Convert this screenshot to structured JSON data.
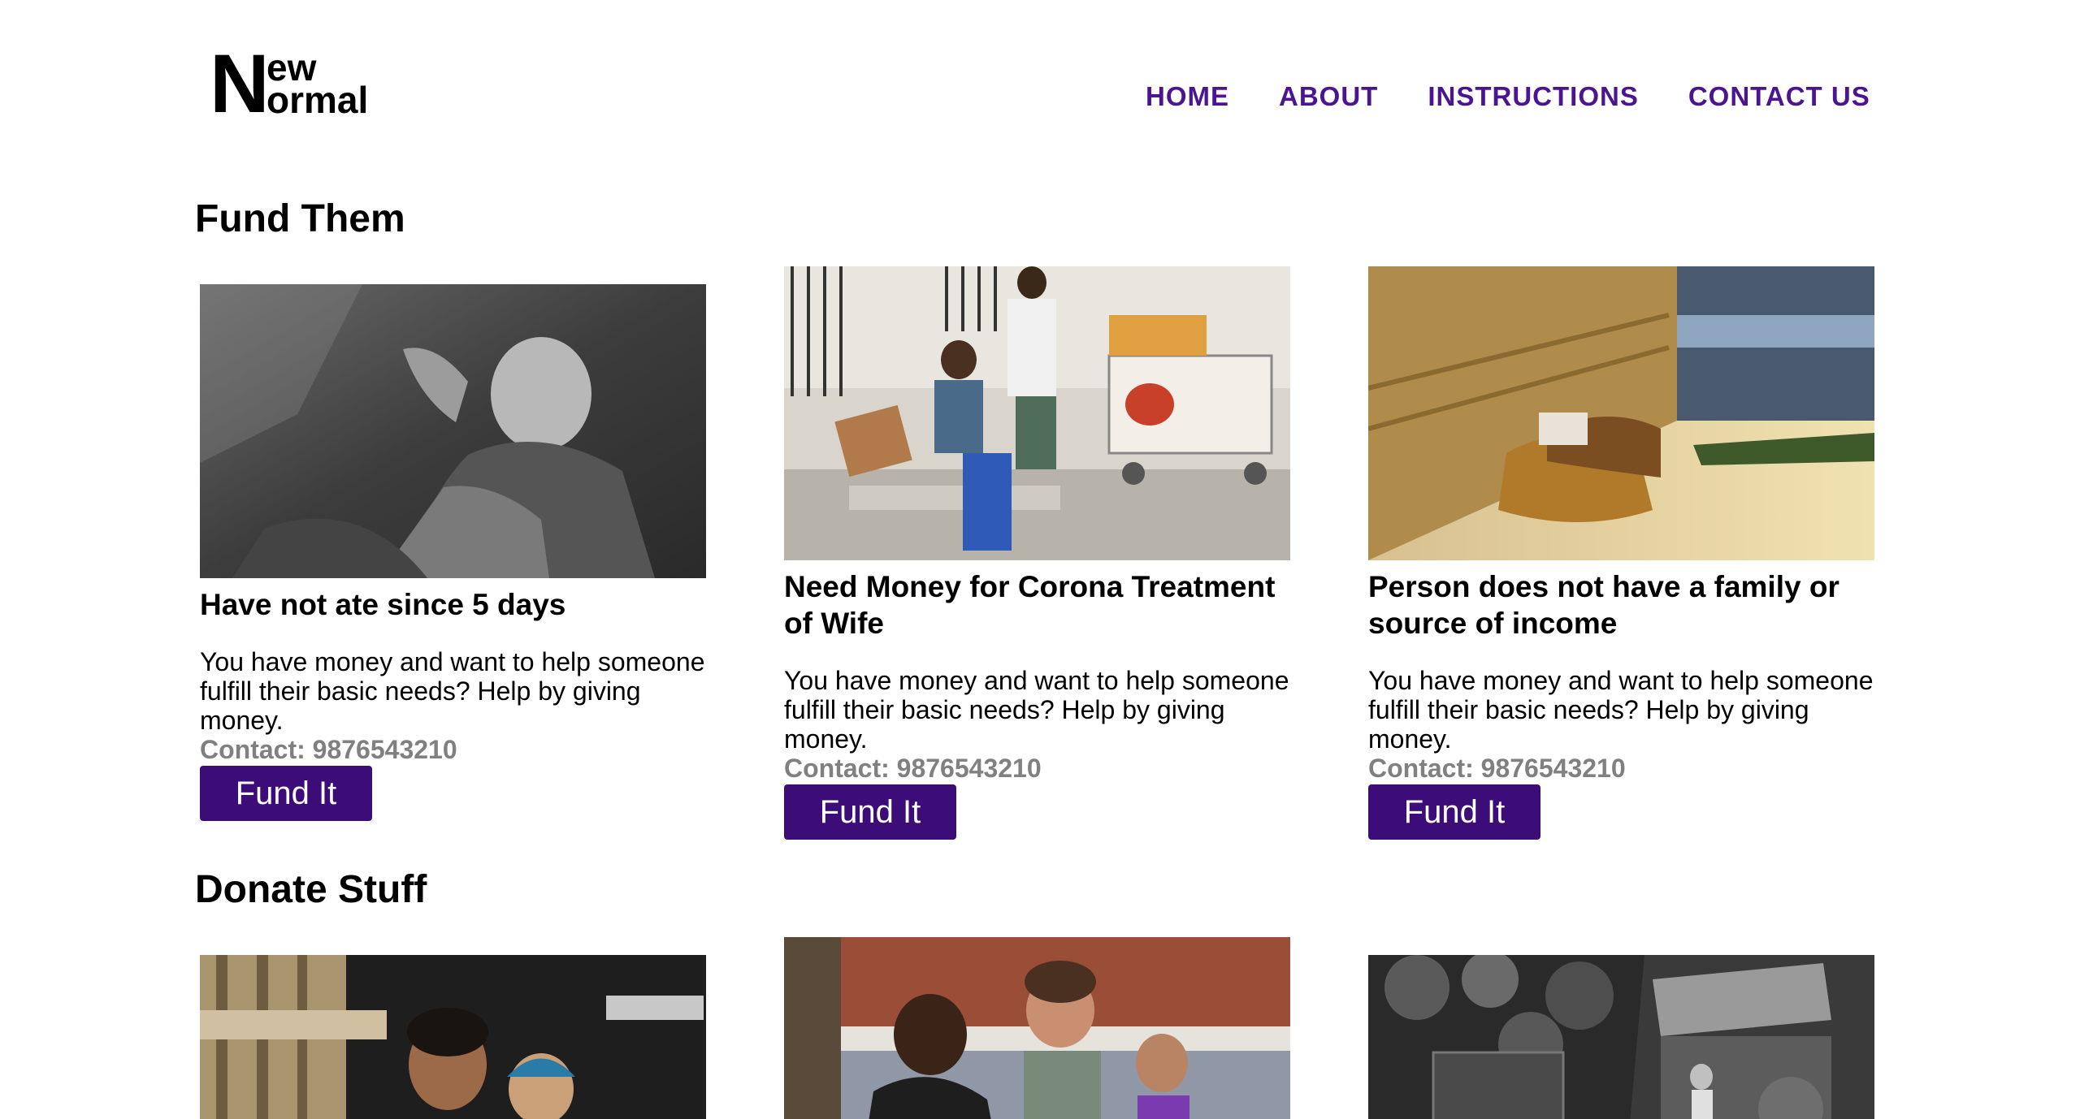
{
  "logo": {
    "big_letter": "N",
    "line1": "ew",
    "line2": "ormal"
  },
  "nav": {
    "home": "HOME",
    "about": "ABOUT",
    "instructions": "INSTRUCTIONS",
    "contact": "CONTACT US"
  },
  "colors": {
    "accent": "#4b1591",
    "button": "#3c0c78",
    "contact": "#808080"
  },
  "sections": {
    "fund": {
      "title": "Fund Them",
      "cards": [
        {
          "title": "Have not ate since 5 days",
          "desc": "You have money and want to help someone fulfill their basic needs? Help by giving money.",
          "contact": "Contact: 9876543210",
          "button": "Fund It",
          "image": "elderly-woman-bw-photo"
        },
        {
          "title": "Need Money for Corona Treatment of Wife",
          "desc": "You have money and want to help someone fulfill their basic needs? Help by giving money.",
          "contact": "Contact: 9876543210",
          "button": "Fund It",
          "image": "street-vendor-photo"
        },
        {
          "title": "Person does not have a family or source of income",
          "desc": "You have money and want to help someone fulfill their basic needs? Help by giving money.",
          "contact": "Contact: 9876543210",
          "button": "Fund It",
          "image": "person-sleeping-on-street-photo"
        }
      ]
    },
    "donate": {
      "title": "Donate Stuff",
      "cards": [
        {
          "image": "woman-and-child-photo"
        },
        {
          "image": "children-outdoors-photo"
        },
        {
          "image": "child-at-shack-bw-photo"
        }
      ]
    }
  }
}
